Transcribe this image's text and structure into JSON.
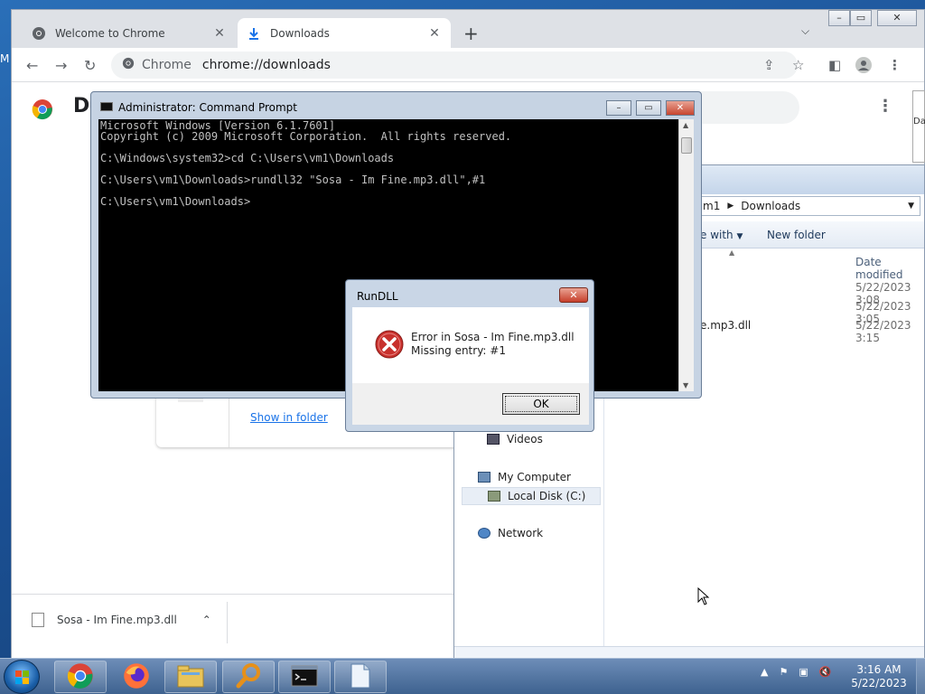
{
  "desktop": {
    "edge_letter": "M"
  },
  "chrome": {
    "tabs": [
      {
        "label": "Welcome to Chrome",
        "icon": "chrome-icon"
      },
      {
        "label": "Downloads",
        "icon": "download-icon"
      }
    ],
    "new_tab": "+",
    "omnibox": {
      "site": "Chrome",
      "url": "chrome://downloads"
    },
    "page": {
      "title_partial": "Do",
      "show_in_folder": "Show in folder"
    },
    "download_bar": {
      "file": "Sosa - Im Fine.mp3.dll"
    }
  },
  "explorer": {
    "breadcrumb": [
      "m1",
      "Downloads"
    ],
    "commands": {
      "open_with": "e with",
      "new_folder": "New folder"
    },
    "column_header": "Date modified",
    "file_partial": "e.mp3.dll",
    "dates": [
      "5/22/2023 3:08",
      "5/22/2023 3:05",
      "5/22/2023 3:15"
    ],
    "nav": {
      "videos": "Videos",
      "my_computer": "My Computer",
      "local_disk": "Local Disk (C:)",
      "network": "Network"
    }
  },
  "bg_window": {
    "text": "Da"
  },
  "cmd": {
    "title": "Administrator: Command Prompt",
    "lines": {
      "l1": "Microsoft Windows [Version 6.1.7601]",
      "l2": "Copyright (c) 2009 Microsoft Corporation.  All rights reserved.",
      "l3": "C:\\Windows\\system32>cd C:\\Users\\vm1\\Downloads",
      "l4": "C:\\Users\\vm1\\Downloads>rundll32 \"Sosa - Im Fine.mp3.dll\",#1",
      "l5": "C:\\Users\\vm1\\Downloads>"
    }
  },
  "dialog": {
    "title": "RunDLL",
    "message_line1": "Error in Sosa - Im Fine.mp3.dll",
    "message_line2": "Missing entry: #1",
    "ok_label": "OK",
    "close_label": "✕"
  },
  "taskbar": {
    "clock_time": "3:16 AM",
    "clock_date": "5/22/2023"
  },
  "colors": {
    "error_red": "#c8312d",
    "link_blue": "#1a73e8",
    "console_bg": "#000000"
  }
}
